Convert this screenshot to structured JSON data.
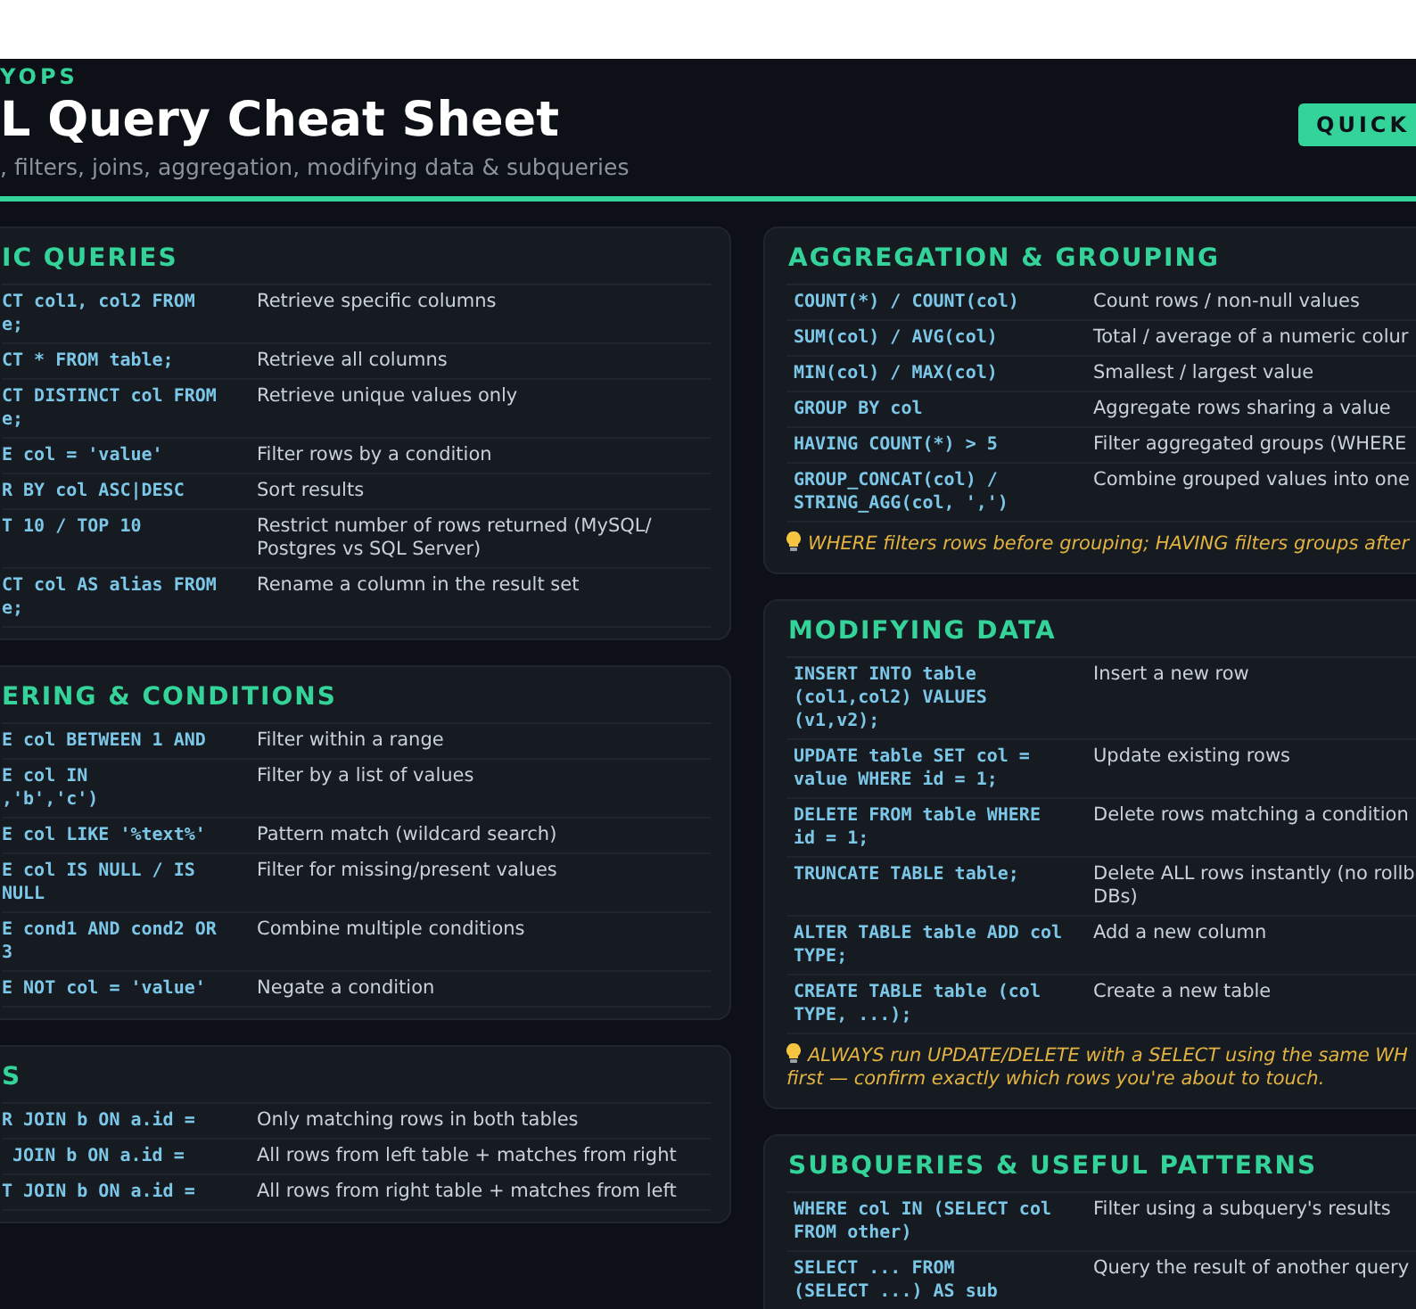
{
  "header": {
    "brand": "YOPS",
    "title": "L Query Cheat Sheet",
    "subtitle": ", filters, joins, aggregation, modifying data & subqueries",
    "badge": "QUICK"
  },
  "left_column": [
    {
      "title": "IC QUERIES",
      "rows": [
        {
          "code": "CT col1, col2 FROM\ne;",
          "description": "Retrieve specific columns"
        },
        {
          "code": "CT * FROM table;",
          "description": "Retrieve all columns"
        },
        {
          "code": "CT DISTINCT col FROM\ne;",
          "description": "Retrieve unique values only"
        },
        {
          "code": "E col = 'value'",
          "description": "Filter rows by a condition"
        },
        {
          "code": "R BY col ASC|DESC",
          "description": "Sort results"
        },
        {
          "code": "T 10 / TOP 10",
          "description": "Restrict number of rows returned (MySQL/\nPostgres vs SQL Server)"
        },
        {
          "code": "CT col AS alias FROM\ne;",
          "description": "Rename a column in the result set"
        }
      ]
    },
    {
      "title": "ERING & CONDITIONS",
      "rows": [
        {
          "code": "E col BETWEEN 1 AND",
          "description": "Filter within a range"
        },
        {
          "code": "E col IN\n,'b','c')",
          "description": "Filter by a list of values"
        },
        {
          "code": "E col LIKE '%text%'",
          "description": "Pattern match (wildcard search)"
        },
        {
          "code": "E col IS NULL / IS\nNULL",
          "description": "Filter for missing/present values"
        },
        {
          "code": "E cond1 AND cond2 OR\n3",
          "description": "Combine multiple conditions"
        },
        {
          "code": "E NOT col = 'value'",
          "description": "Negate a condition"
        }
      ]
    },
    {
      "title": "S",
      "rows": [
        {
          "code": "R JOIN b ON a.id =",
          "description": "Only matching rows in both tables"
        },
        {
          "code": " JOIN b ON a.id =",
          "description": "All rows from left table + matches from right"
        },
        {
          "code": "T JOIN b ON a.id =",
          "description": "All rows from right table + matches from left"
        }
      ]
    }
  ],
  "right_column": [
    {
      "title": "AGGREGATION & GROUPING",
      "rows": [
        {
          "code": "COUNT(*) / COUNT(col)",
          "description": "Count rows / non-null values"
        },
        {
          "code": "SUM(col) / AVG(col)",
          "description": "Total / average of a numeric colur"
        },
        {
          "code": "MIN(col) / MAX(col)",
          "description": "Smallest / largest value"
        },
        {
          "code": "GROUP BY col",
          "description": "Aggregate rows sharing a value"
        },
        {
          "code": "HAVING COUNT(*) > 5",
          "description": "Filter aggregated groups (WHERE"
        },
        {
          "code": "GROUP_CONCAT(col) /\nSTRING_AGG(col, ',')",
          "description": "Combine grouped values into one"
        }
      ],
      "tip": "WHERE filters rows before grouping; HAVING filters groups after"
    },
    {
      "title": "MODIFYING DATA",
      "rows": [
        {
          "code": "INSERT INTO table\n(col1,col2) VALUES\n(v1,v2);",
          "description": "Insert a new row"
        },
        {
          "code": "UPDATE table SET col =\nvalue WHERE id = 1;",
          "description": "Update existing rows"
        },
        {
          "code": "DELETE FROM table WHERE\nid = 1;",
          "description": "Delete rows matching a condition"
        },
        {
          "code": "TRUNCATE TABLE table;",
          "description": "Delete ALL rows instantly (no rollb\nDBs)"
        },
        {
          "code": "ALTER TABLE table ADD col\nTYPE;",
          "description": "Add a new column"
        },
        {
          "code": "CREATE TABLE table (col\nTYPE, ...);",
          "description": "Create a new table"
        }
      ],
      "tip": "ALWAYS run UPDATE/DELETE with a SELECT using the same WH\nfirst — confirm exactly which rows you're about to touch."
    },
    {
      "title": "SUBQUERIES & USEFUL PATTERNS",
      "rows": [
        {
          "code": "WHERE col IN (SELECT col\nFROM other)",
          "description": "Filter using a subquery's results"
        },
        {
          "code": "SELECT ... FROM\n(SELECT ...) AS sub",
          "description": "Query the result of another query"
        }
      ]
    }
  ]
}
